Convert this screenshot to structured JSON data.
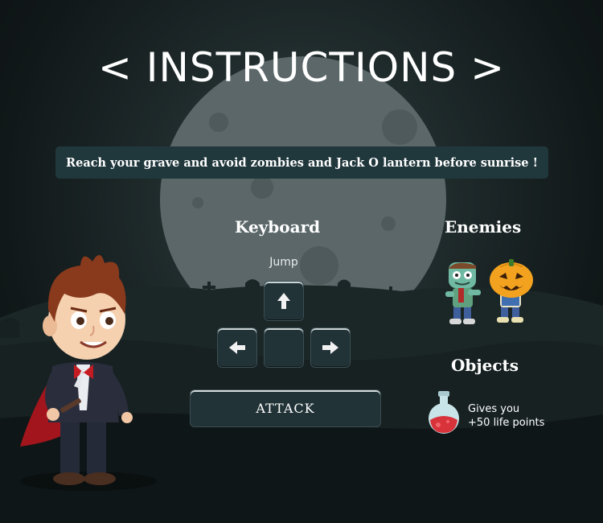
{
  "title": "< INSTRUCTIONS >",
  "objective": "Reach your grave and avoid zombies and Jack O lantern before sunrise !",
  "keyboard": {
    "heading": "Keyboard",
    "jump_label": "Jump",
    "attack_label": "ATTACK"
  },
  "enemies": {
    "heading": "Enemies",
    "items": [
      "zombie-icon",
      "jack-o-lantern-icon"
    ]
  },
  "objects": {
    "heading": "Objects",
    "potion_line1": "Gives you",
    "potion_line2": "+50 life points"
  },
  "colors": {
    "background": "#111819",
    "moon": "#5e6b6d",
    "panel": "#223338",
    "banner": "#20373c",
    "text": "#ffffff"
  },
  "player": "vampire-icon"
}
